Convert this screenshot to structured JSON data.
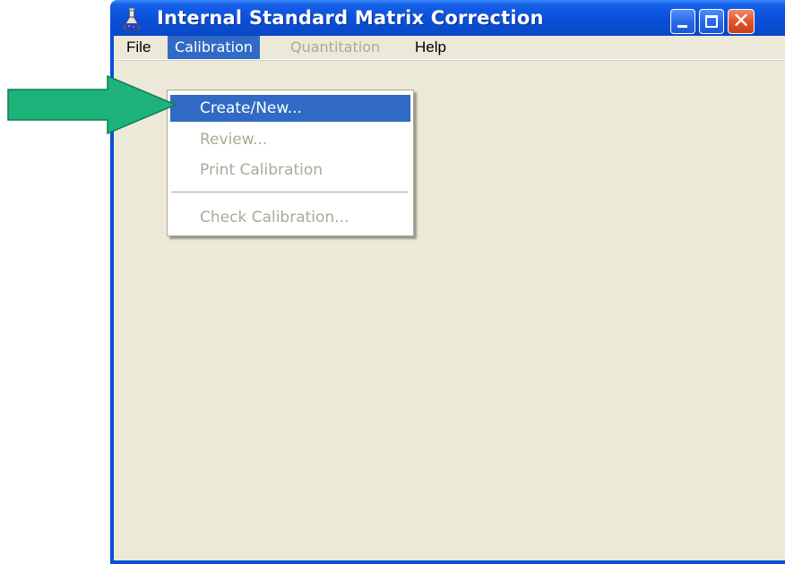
{
  "window": {
    "title": "Internal Standard Matrix Correction",
    "icon": "flask-icon",
    "title_bar_color": "#0a4fd8",
    "close_button_color": "#e2542a"
  },
  "menubar": {
    "items": [
      {
        "label": "File",
        "state": "normal"
      },
      {
        "label": "Calibration",
        "state": "open"
      },
      {
        "label": "Quantitation",
        "state": "disabled"
      },
      {
        "label": "Help",
        "state": "normal"
      }
    ]
  },
  "calibration_menu": {
    "items": [
      {
        "label": "Create/New...",
        "state": "highlighted"
      },
      {
        "label": "Review...",
        "state": "disabled"
      },
      {
        "label": "Print Calibration",
        "state": "disabled"
      },
      {
        "label": "Check Calibration...",
        "state": "disabled"
      }
    ],
    "highlight_color": "#316ac5"
  },
  "annotation": {
    "icon": "green-arrow-icon",
    "color": "#1db37a"
  }
}
